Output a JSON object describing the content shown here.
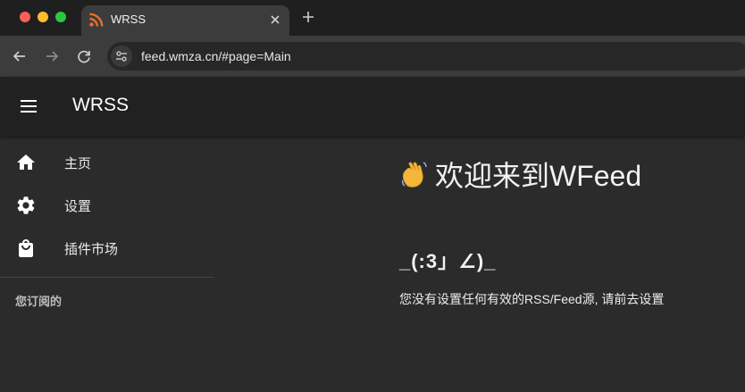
{
  "browser": {
    "tab": {
      "title": "WRSS",
      "favicon": "rss-icon",
      "close_icon": "close-icon"
    },
    "new_tab_icon": "plus-icon",
    "toolbar": {
      "back_icon": "arrow-left-icon",
      "forward_icon": "arrow-right-icon",
      "reload_icon": "reload-icon",
      "site_info_icon": "tune-icon",
      "url": "feed.wmza.cn/#page=Main"
    }
  },
  "appbar": {
    "menu_icon": "hamburger-icon",
    "title": "WRSS"
  },
  "drawer": {
    "items": [
      {
        "label": "主页",
        "icon": "home-icon"
      },
      {
        "label": "设置",
        "icon": "gear-icon"
      },
      {
        "label": "插件市场",
        "icon": "shopping-bag-icon"
      }
    ],
    "subheader": "您订阅的"
  },
  "main": {
    "welcome_emoji": "waving-hand-icon",
    "welcome_text": "欢迎来到WFeed",
    "kaomoji": "_(:3」∠)_",
    "hint": "您没有设置任何有效的RSS/Feed源, 请前去设置"
  },
  "colors": {
    "tabstrip": "#1f1f1f",
    "toolbar": "#3c3c3c",
    "appbar": "#212121",
    "background": "#2b2b2b",
    "rss_orange": "#e8702a"
  }
}
